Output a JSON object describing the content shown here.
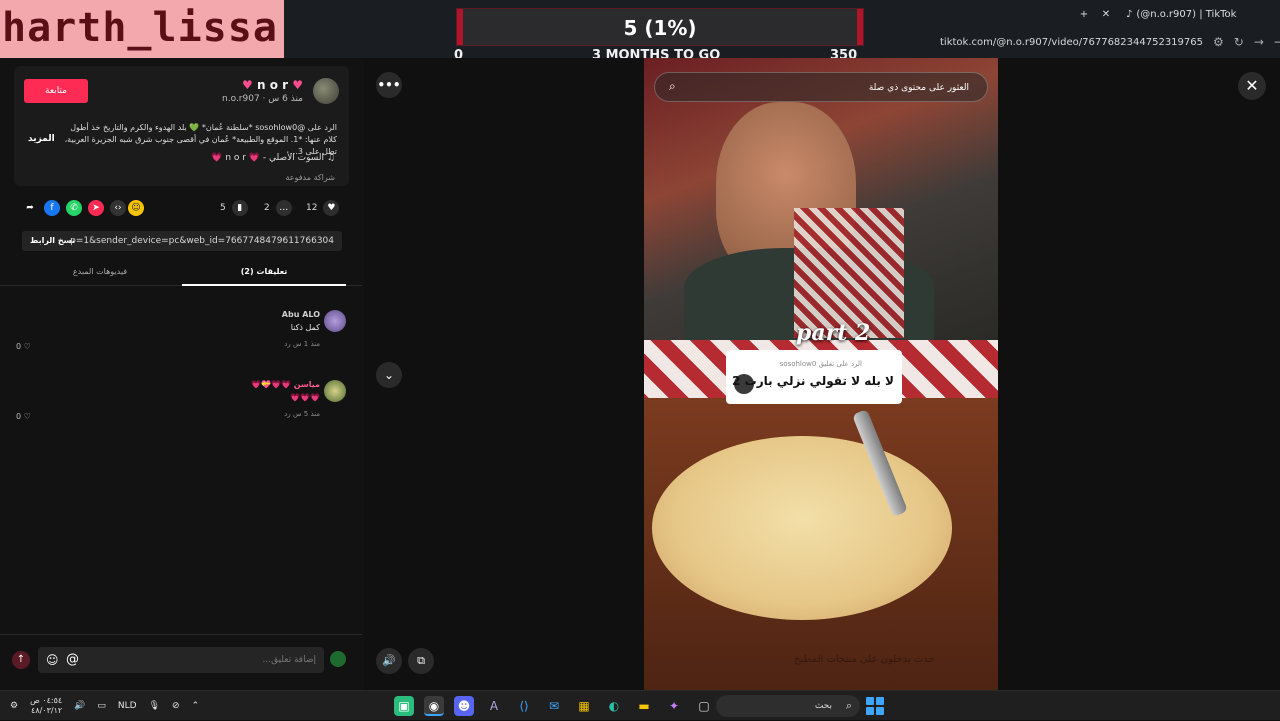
{
  "stream_overlay": {
    "name": "harth_lissa"
  },
  "goal": {
    "value_label": "5 (1%)",
    "min": "0",
    "max": "350",
    "subtitle": "3 MONTHS TO GO",
    "progress": 0.014
  },
  "browser": {
    "tab_title": "(@n.o.r907) | TikTok",
    "url": "tiktok.com/@n.o.r907/video/7677682344752319765"
  },
  "post": {
    "author_name": "n o r",
    "author_meta": "n.o.r907 · منذ 6 س",
    "follow_label": "متابعة",
    "description": "الرد على @sosohlow0 *سلطنة عُمان* 💚 بلد الهدوء والكرم والتاريخ خذ أطول كلام عنها: *1. الموقع والطبيعة* عُمان في أقصى جنوب شرق شبه الجزيرة العربية، تطل على 3...",
    "mention": "sosohlow0",
    "more_label": "المزيد",
    "sound": "السوت الأصلي - 💗 n o r 💗",
    "paid_label": "شراكة مدفوعة",
    "likes": "12",
    "comments": "2",
    "saves": "5",
    "copy_url": "...p=1&sender_device=pc&web_id=7667748479611766304",
    "copy_label": "نسخ الرابط"
  },
  "tabs": {
    "comments": "تعليقات (2)",
    "creator_videos": "فيديوهات المبدع"
  },
  "comments": [
    {
      "user": "Abu ALO",
      "text": "كمل ذكنا",
      "meta": "منذ 1 س  رد",
      "likes": "0"
    },
    {
      "user": "مياسن 💗💗💝💗",
      "text": "💗💗💗",
      "meta": "منذ 5 س  رد",
      "likes": "0"
    }
  ],
  "comment_input": {
    "placeholder": "إضافة تعليق..."
  },
  "video": {
    "search_text": "العثور على محتوى ذي صلة",
    "part_label": "part 2",
    "reply_sub": "الرد على تعليق sosohlow0",
    "reply_text": "لا بله لا تقولي نزلي بارت 2",
    "caption": "حدث يدخلون على منتجات المطبخ"
  },
  "taskbar": {
    "language": "NLD",
    "time": "٠٤:٥٤ ص",
    "date": "٤٨/٠٣/١٢",
    "search_label": "بحث"
  },
  "colors": {
    "accent": "#fe2c55",
    "goal_fill": "#b0142b",
    "overlay_bg": "#f3a8ad"
  }
}
